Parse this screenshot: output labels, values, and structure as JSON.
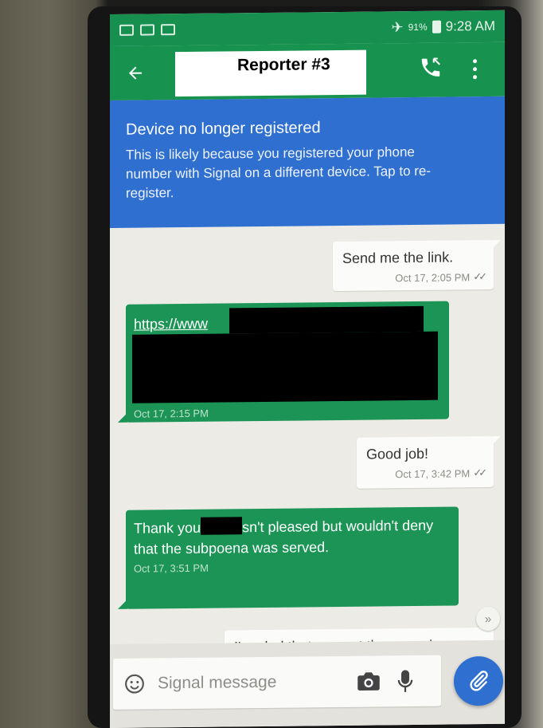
{
  "status_bar": {
    "battery": "91%",
    "time": "9:28 AM",
    "icons": [
      "email-icon",
      "mail-icon",
      "calendar-icon",
      "airplane-mode-icon",
      "battery-charging-icon"
    ]
  },
  "toolbar": {
    "title": "Reporter #3",
    "back_icon": "arrow-left-icon",
    "call_icon": "phone-icon",
    "menu_icon": "more-vert-icon"
  },
  "banner": {
    "title": "Device no longer registered",
    "body": "This is likely because you registered your phone number with Signal on a different device. Tap to re-register."
  },
  "messages": [
    {
      "direction": "outgoing",
      "text": "Send me the link.",
      "timestamp": "Oct 17, 2:05 PM",
      "delivered": true
    },
    {
      "direction": "incoming",
      "text": "https://www",
      "timestamp": "Oct 17, 2:15 PM",
      "redacted": true
    },
    {
      "direction": "outgoing",
      "text": "Good job!",
      "timestamp": "Oct 17, 3:42 PM",
      "delivered": true
    },
    {
      "direction": "incoming",
      "text_a": "Thank you",
      "text_b": "sn't pleased but wouldn't deny that the subpoena was served.",
      "timestamp": "Oct 17, 3:51 PM",
      "redacted": true
    },
    {
      "direction": "outgoing",
      "text": "I'm glad that you got the scoop!"
    }
  ],
  "compose": {
    "placeholder": "Signal message",
    "emoji_icon": "smiley-icon",
    "camera_icon": "camera-icon",
    "mic_icon": "microphone-icon",
    "attach_icon": "paperclip-icon"
  },
  "colors": {
    "toolbar": "#17934f",
    "banner": "#2f6fcf",
    "incoming_bubble": "#1b9456",
    "outgoing_bubble": "#fbfbf9"
  }
}
